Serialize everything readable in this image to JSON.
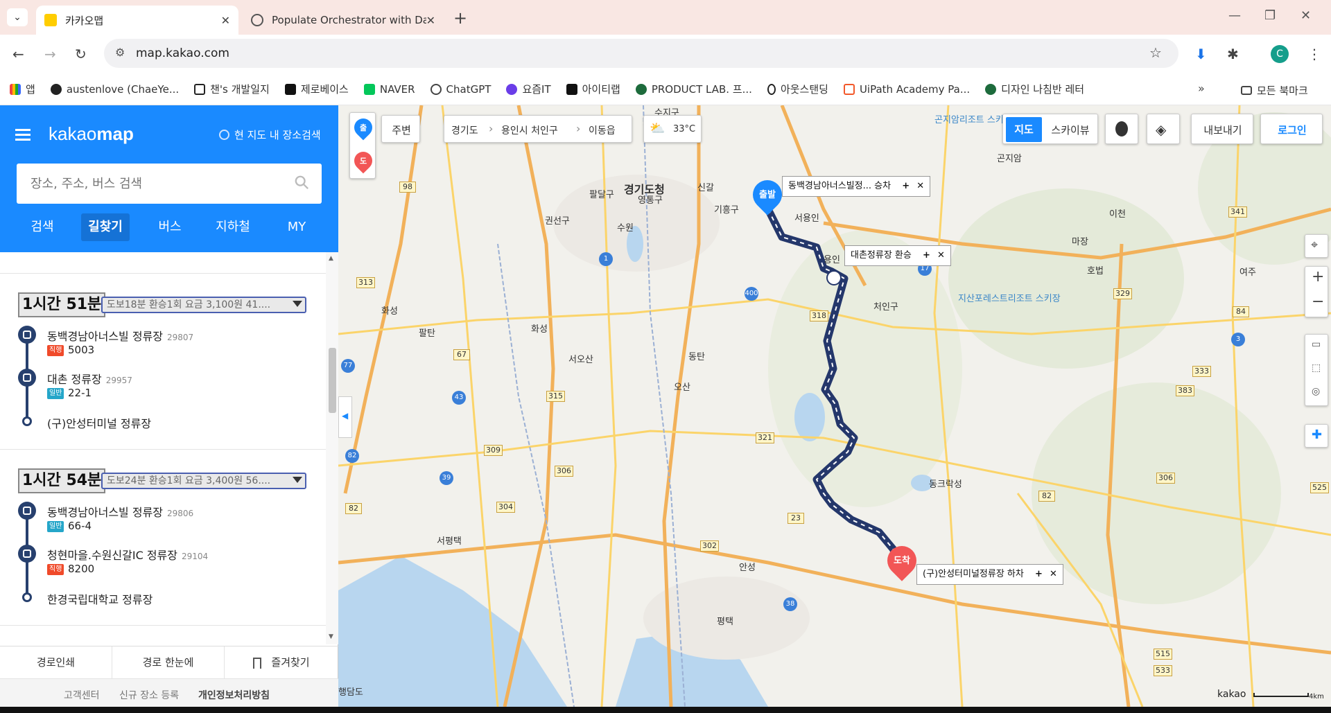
{
  "browser": {
    "tabs": [
      {
        "title": "카카오맵",
        "active": true
      },
      {
        "title": "Populate Orchestrator with Da",
        "active": false
      }
    ],
    "url": "map.kakao.com",
    "profile_initial": "C",
    "bookmarks": [
      "앱",
      "austenlove (ChaeYe...",
      "챈's 개발일지",
      "제로베이스",
      "NAVER",
      "ChatGPT",
      "요즘IT",
      "아이티랩",
      "PRODUCT LAB. 프...",
      "아웃스탠딩",
      "UiPath Academy Pa...",
      "디자인 나침반 레터"
    ],
    "all_bookmarks": "모든 북마크"
  },
  "panel": {
    "logo": "kakaomap",
    "logo_parts": [
      "kakao",
      "map"
    ],
    "in_map_search": "현 지도 내 장소검색",
    "search_placeholder": "장소, 주소, 버스 검색",
    "tabs": [
      "검색",
      "길찾기",
      "버스",
      "지하철",
      "MY"
    ],
    "active_tab": "길찾기",
    "routes": [
      {
        "time": "1시간 51분",
        "summary": "도보18분   환승1회   요금 3,100원   41....",
        "stops": [
          {
            "name": "동백경남아너스빌 정류장",
            "id": "29807",
            "badge": "직행",
            "badge_color": "#f04a2a",
            "bus": "5003"
          },
          {
            "name": "대촌 정류장",
            "id": "29957",
            "badge": "일반",
            "badge_color": "#25a6c9",
            "bus": "22-1"
          },
          {
            "name": "(구)안성터미널 정류장"
          }
        ]
      },
      {
        "time": "1시간 54분",
        "summary": "도보24분   환승1회   요금 3,400원   56....",
        "stops": [
          {
            "name": "동백경남아너스빌 정류장",
            "id": "29806",
            "badge": "일반",
            "badge_color": "#25a6c9",
            "bus": "66-4"
          },
          {
            "name": "청현마을.수원신갈IC 정류장",
            "id": "29104",
            "badge": "직행",
            "badge_color": "#f04a2a",
            "bus": "8200"
          },
          {
            "name": "한경국립대학교 정류장"
          }
        ]
      }
    ],
    "footer_buttons": [
      "경로인쇄",
      "경로 한눈에",
      "즐겨찾기"
    ],
    "footer_links": [
      "고객센터",
      "신규 장소 등록",
      "개인정보처리방침"
    ]
  },
  "map": {
    "marker_start": "출",
    "marker_dest": "도",
    "nearby": "주변",
    "breadcrumb": [
      "경기도",
      "용인시 처인구",
      "이동읍"
    ],
    "weather": "33°C",
    "view_toggle": [
      "지도",
      "스카이뷰"
    ],
    "export": "내보내기",
    "login": "로그인",
    "route_labels": {
      "start_pin": "출발",
      "end_pin": "도착",
      "start": "동백경남아너스빌정...   승차",
      "transfer": "대촌정류장 환승",
      "end": "(구)안성터미널정류장 하차"
    },
    "places": [
      "경기도청",
      "영통구",
      "수원",
      "팔달구",
      "권선구",
      "화성",
      "오산",
      "서오산",
      "동탄",
      "평택",
      "안성",
      "기흥구",
      "서용인",
      "용인",
      "처인구",
      "이천",
      "곤지암리조트 스키장",
      "지산포레스트리조트 스키장",
      "동크락성",
      "서평택",
      "수지구",
      "신갈",
      "팔탄",
      "화성",
      "마장",
      "호법",
      "곤지암",
      "여주",
      "행담도"
    ],
    "scale": "4km",
    "brand": "kakao",
    "route_color": "#24376b"
  }
}
